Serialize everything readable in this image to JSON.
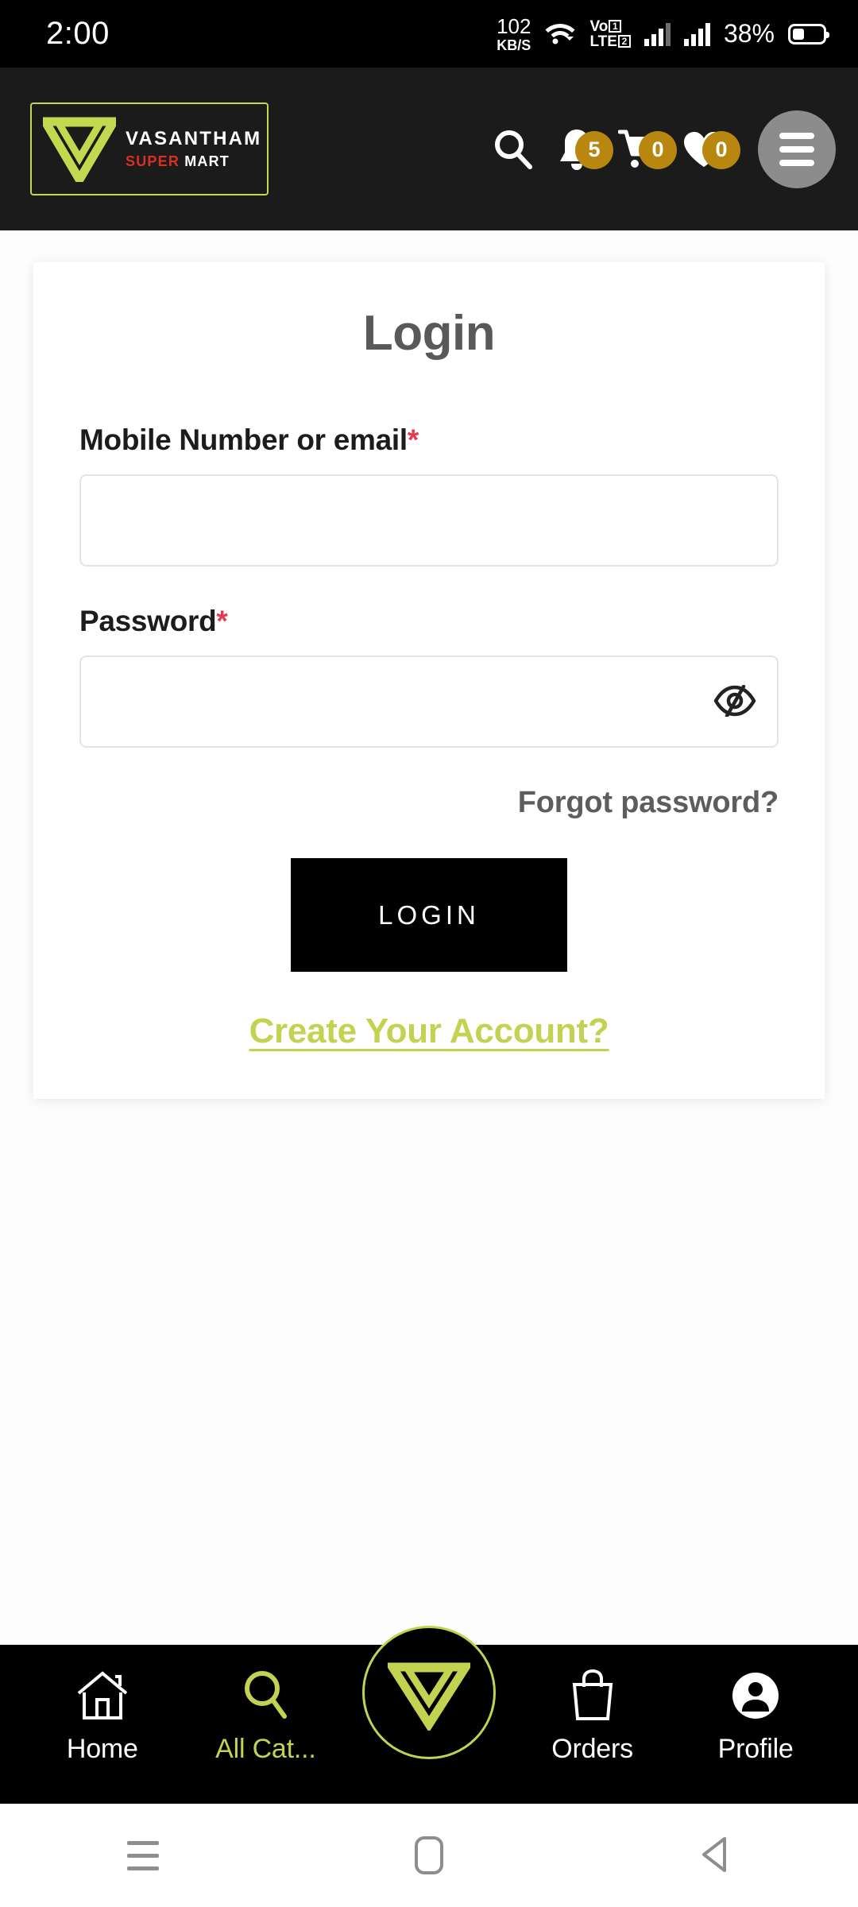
{
  "status_bar": {
    "clock": "2:00",
    "net_speed_value": "102",
    "net_speed_unit": "KB/S",
    "wifi_icon": "wifi-icon",
    "volte_top": "Vo",
    "volte_bottom": "LTE",
    "sim1_badge": "1",
    "sim2_badge": "2",
    "battery_percent": "38%"
  },
  "header": {
    "brand_name": "VASANTHAM",
    "brand_sub_super": "SUPER",
    "brand_sub_mart": "MART",
    "search_icon": "search-icon",
    "notifications_icon": "bell-icon",
    "notifications_count": "5",
    "cart_icon": "cart-icon",
    "cart_count": "0",
    "wishlist_icon": "heart-icon",
    "wishlist_count": "0",
    "menu_icon": "hamburger-menu-icon",
    "badge_color": "#b8870f",
    "brand_accent": "#c3d84f",
    "bar_color": "#1b1b1b"
  },
  "login_card": {
    "title": "Login",
    "mobile_label": "Mobile Number or email",
    "mobile_required_mark": "*",
    "mobile_value": "",
    "mobile_placeholder": "",
    "password_label": "Password",
    "password_required_mark": "*",
    "password_value": "",
    "password_placeholder": "",
    "password_toggle_icon": "eye-off-icon",
    "forgot_password": "Forgot password?",
    "login_button": "LOGIN",
    "create_account": "Create Your Account?",
    "required_color": "#e03b52",
    "link_color": "#c3d250",
    "button_color": "#000000"
  },
  "bottom_nav": {
    "items": [
      {
        "label": "Home",
        "icon": "home-icon",
        "active": false
      },
      {
        "label": "All Cat...",
        "icon": "search-icon",
        "active": true
      },
      {
        "label": "Orders",
        "icon": "shopping-bag-icon",
        "active": false
      },
      {
        "label": "Profile",
        "icon": "person-icon",
        "active": false
      }
    ],
    "center_icon": "vasantham-v-logo-icon",
    "active_color": "#c3d250"
  },
  "android_nav": {
    "recents_icon": "recents-icon",
    "home_icon": "home-square-icon",
    "back_icon": "back-triangle-icon"
  }
}
